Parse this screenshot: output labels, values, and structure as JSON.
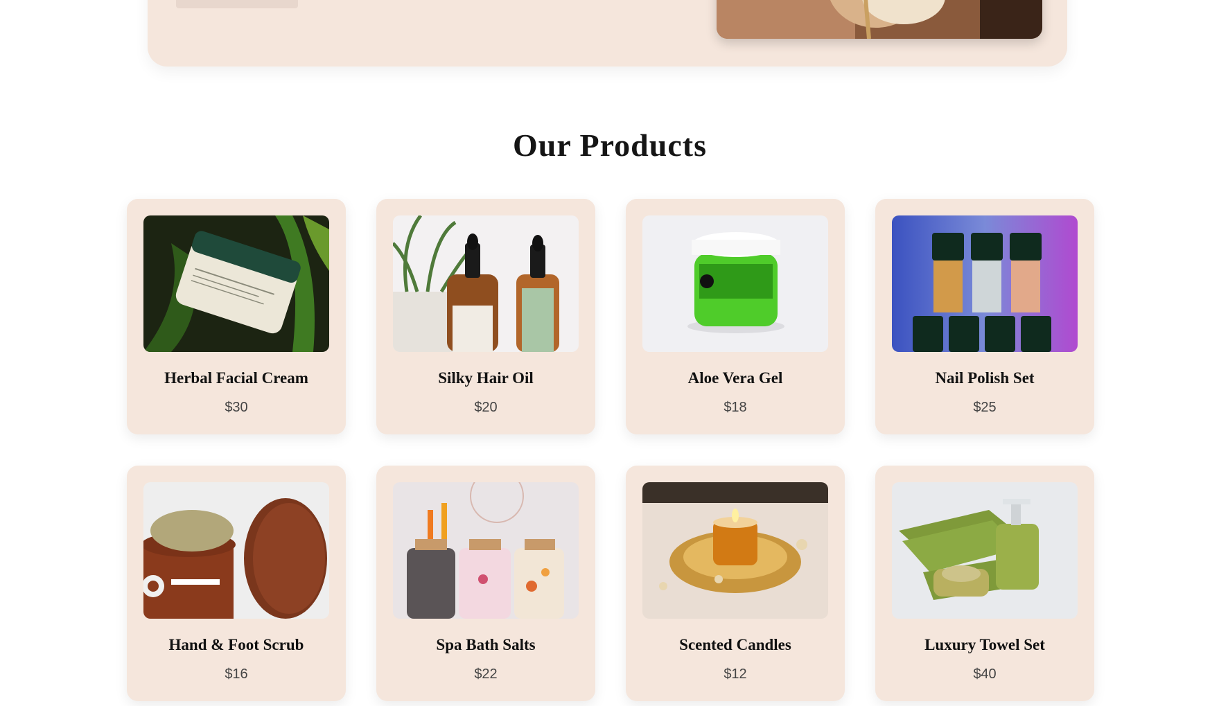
{
  "section": {
    "title": "Our Products"
  },
  "products": [
    {
      "name": "Herbal Facial Cream",
      "price": "$30"
    },
    {
      "name": "Silky Hair Oil",
      "price": "$20"
    },
    {
      "name": "Aloe Vera Gel",
      "price": "$18"
    },
    {
      "name": "Nail Polish Set",
      "price": "$25"
    },
    {
      "name": "Hand & Foot Scrub",
      "price": "$16"
    },
    {
      "name": "Spa Bath Salts",
      "price": "$22"
    },
    {
      "name": "Scented Candles",
      "price": "$12"
    },
    {
      "name": "Luxury Towel Set",
      "price": "$40"
    }
  ],
  "colors": {
    "card_bg": "#f5e6dc",
    "page_bg": "#ffffff"
  }
}
